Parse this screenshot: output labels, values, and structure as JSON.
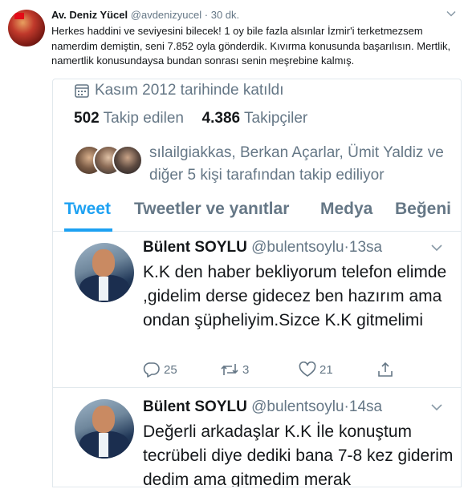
{
  "outer_tweet": {
    "name": "Av. Deniz Yücel",
    "handle": "@avdenizyucel",
    "separator": "·",
    "time": "30 dk.",
    "text": "Herkes haddini ve seviyesini bilecek! 1 oy bile fazla alsınlar İzmir'i terketmezsem namerdim demiştin, seni 7.852 oyla gönderdik. Kıvırma konusunda başarılısın. Mertlik, namertlik konusundaysa bundan sonrası senin meşrebine kalmış."
  },
  "card": {
    "joined": "Kasım 2012 tarihinde katıldı",
    "following_count": "502",
    "following_label": "Takip edilen",
    "followers_count": "4.386",
    "followers_label": "Takipçiler",
    "known_followers": "sılailgiakkas, Berkan Açarlar, Ümit Yaldiz ve diğer 5 kişi tarafından takip ediliyor",
    "tabs": [
      {
        "label": "Tweet",
        "active": true
      },
      {
        "label": "Tweetler ve yanıtlar",
        "active": false
      },
      {
        "label": "Medya",
        "active": false
      },
      {
        "label": "Beğeni",
        "active": false
      }
    ],
    "tweets": [
      {
        "name": "Bülent SOYLU",
        "handle": "@bulentsoylu",
        "separator": "·",
        "time": "13sa",
        "text": "K.K den haber bekliyorum telefon elimde ,gidelim derse gidecez ben hazırım ama ondan şüpheliyim.Sizce K.K gitmelimi",
        "replies": "25",
        "retweets": "3",
        "likes": "21"
      },
      {
        "name": "Bülent SOYLU",
        "handle": "@bulentsoylu",
        "separator": "·",
        "time": "14sa",
        "text": "Değerli arkadaşlar K.K İle konuştum tecrübeli diye dediki bana 7-8 kez giderim dedim ama gitmedim merak"
      }
    ]
  },
  "colors": {
    "accent": "#1da1f2",
    "secondary_text": "#657786",
    "primary_text": "#14171a",
    "border": "#e1e8ed"
  },
  "icons": [
    "chevron-down-icon",
    "calendar-icon",
    "reply-icon",
    "retweet-icon",
    "like-icon",
    "share-icon"
  ]
}
